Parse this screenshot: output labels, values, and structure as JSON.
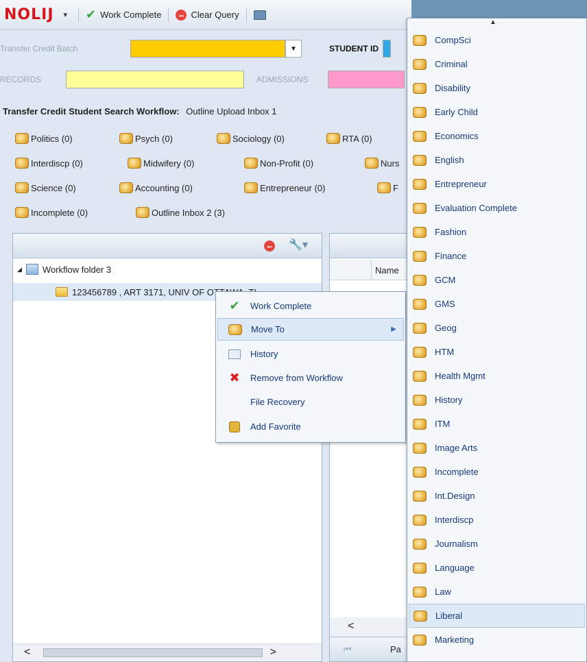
{
  "toolbar": {
    "logo": "NOLIJ",
    "menu_arrow": "▾",
    "work_complete": "Work Complete",
    "clear_query": "Clear Query"
  },
  "form": {
    "transfer_credit_batch": "Transfer Credit Batch",
    "student_id": "STUDENT ID",
    "records": "RECORDS",
    "admissions": "ADMISSIONS",
    "colors": {
      "batch_field": "#ffcc00",
      "records_field": "#ffff99",
      "admissions_field": "#ff99cc"
    }
  },
  "workflow": {
    "title_bold": "Transfer Credit Student Search Workflow:",
    "title_rest": "Outline Upload Inbox 1",
    "chips": [
      "Politics (0)",
      "Psych (0)",
      "Sociology (0)",
      "RTA (0)",
      "Interdiscp (0)",
      "Midwifery (0)",
      "Non-Profit (0)",
      "Nurs",
      "Science (0)",
      "Accounting (0)",
      "Entrepreneur (0)",
      "F",
      "Incomplete (0)",
      "Outline Inbox 2 (3)"
    ]
  },
  "tree": {
    "folder": "Workflow folder 3",
    "document": "123456789 , ART 3171, UNIV OF OTTAWA, TI"
  },
  "right_panel": {
    "name_header": "Name",
    "pager_label": "Pa"
  },
  "context_menu": {
    "items": [
      "Work Complete",
      "Move To",
      "History",
      "Remove from Workflow",
      "File Recovery",
      "Add Favorite"
    ]
  },
  "move_to_list": {
    "items": [
      "CompSci",
      "Criminal",
      "Disability",
      "Early Child",
      "Economics",
      "English",
      "Entrepreneur",
      "Evaluation Complete",
      "Fashion",
      "Finance",
      "GCM",
      "GMS",
      "Geog",
      "HTM",
      "Health Mgmt",
      "History",
      "ITM",
      "Image Arts",
      "Incomplete",
      "Int.Design",
      "Interdiscp",
      "Journalism",
      "Language",
      "Law",
      "Liberal",
      "Marketing"
    ],
    "active_item": "Liberal"
  }
}
